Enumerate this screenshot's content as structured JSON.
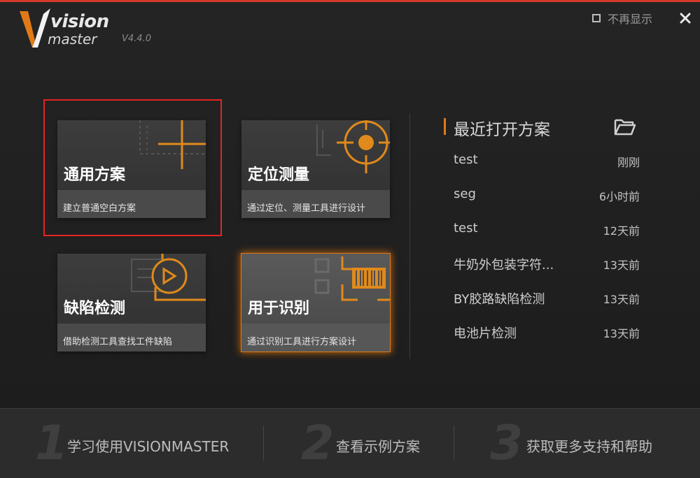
{
  "app": {
    "logo_text_vision": "vision",
    "logo_text_master": "master",
    "version": "V4.4.0"
  },
  "header": {
    "dont_show_label": "不再显示",
    "dont_show_checked": false,
    "close_icon": "close-icon"
  },
  "colors": {
    "accent": "#e07a17",
    "selection": "#e52421",
    "background": "#1e1e1e"
  },
  "cards": [
    {
      "title": "通用方案",
      "desc": "建立普通空白方案",
      "icon": "crosshair-grid-icon",
      "selected": true
    },
    {
      "title": "定位测量",
      "desc": "通过定位、测量工具进行设计",
      "icon": "target-icon"
    },
    {
      "title": "缺陷检测",
      "desc": "借助检测工具查找工件缺陷",
      "icon": "defect-inspect-icon"
    },
    {
      "title": "用于识别",
      "desc": "通过识别工具进行方案设计",
      "icon": "barcode-scan-icon",
      "highlighted": true
    }
  ],
  "recent": {
    "title": "最近打开方案",
    "folder_icon": "folder-open-icon",
    "items": [
      {
        "name": "test",
        "time": "刚刚"
      },
      {
        "name": "seg",
        "time": "6小时前"
      },
      {
        "name": "test",
        "time": "12天前"
      },
      {
        "name": "牛奶外包装字符...",
        "time": "13天前"
      },
      {
        "name": "BY胶路缺陷检测",
        "time": "13天前"
      },
      {
        "name": "电池片检测",
        "time": "13天前"
      }
    ]
  },
  "footer": {
    "steps": [
      {
        "num": "1",
        "label": "学习使用VISIONMASTER"
      },
      {
        "num": "2",
        "label": "查看示例方案"
      },
      {
        "num": "3",
        "label": "获取更多支持和帮助"
      }
    ]
  }
}
